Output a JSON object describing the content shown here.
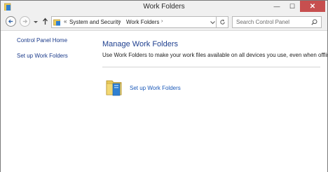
{
  "window": {
    "title": "Work Folders",
    "minimize_glyph": "—",
    "maximize_glyph": "☐",
    "close_glyph": "✕"
  },
  "navigation": {
    "back_icon": "back-arrow-icon",
    "forward_icon": "forward-arrow-icon",
    "recent_icon": "chevron-down-icon",
    "up_icon": "up-arrow-icon"
  },
  "address_bar": {
    "prefix": "«",
    "breadcrumbs": [
      "System and Security",
      "Work Folders"
    ],
    "separator": "›",
    "refresh_icon": "refresh-icon"
  },
  "search": {
    "placeholder": "Search Control Panel",
    "icon": "search-icon"
  },
  "sidebar": {
    "items": [
      {
        "label": "Control Panel Home"
      },
      {
        "label": "Set up Work Folders"
      }
    ]
  },
  "main": {
    "title": "Manage Work Folders",
    "description": "Use Work Folders to make your work files available on all devices you use, even when offline.",
    "action": {
      "label": "Set up Work Folders",
      "icon": "work-folders-icon"
    }
  },
  "colors": {
    "link": "#1a3a8a",
    "heading": "#1e3f8f",
    "action_link": "#1a58b8",
    "close_button": "#c74f4f",
    "folder_yellow": "#e8c95a",
    "folder_blue": "#2f7fd1"
  }
}
